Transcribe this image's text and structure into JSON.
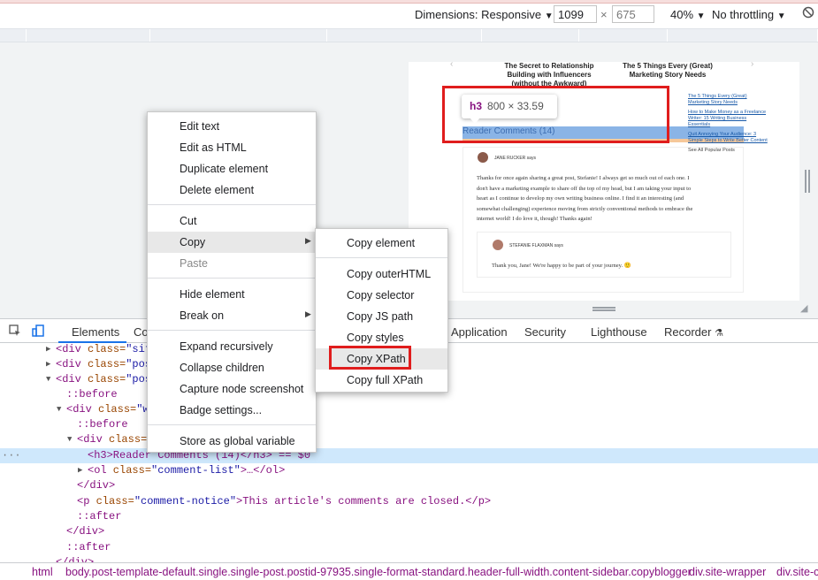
{
  "toolbar": {
    "dimensions_label": "Dimensions: Responsive",
    "width_value": "1099",
    "times": "×",
    "height_value": "675",
    "zoom": "40%",
    "throttling": "No throttling",
    "rotate_icon": "rotate-icon"
  },
  "preview": {
    "related_1": "The Secret to Relationship Building with Influencers (without the Awkward)",
    "related_1_a": "The Secret to Relationship",
    "related_1_b": "Building with Influencers",
    "related_1_c": "(without the Awkward)",
    "related_2_a": "The 5 Things Every (Great)",
    "related_2_b": "Marketing Story Needs",
    "heading": "Reader Comments (14)",
    "sidebar_links": [
      "The 5 Things Every (Great) Marketing Story Needs",
      "How to Make Money as a Freelance Writer: 15 Writing Business Essentials",
      "Quit Annoying Your Audience: 3 Simple Steps to Write Better Content"
    ],
    "sidebar_popular": "See All Popular Posts",
    "comment_author": "JANE RUCKER says",
    "comment_lines": [
      "Thanks for once again sharing a great post, Stefanie! I always get so much out of each one. I",
      "don't have a marketing example to share off the top of my head, but I am taking your input to",
      "heart as I continue to develop my own writing business online. I find it an interesting (and",
      "somewhat challenging) experience moving from strictly conventional methods to embrace the",
      "internet world! I do love it, though! Thanks again!"
    ],
    "reply_author": "STEFANIE FLAXMAN says",
    "reply_text": "Thank you, Jane! We're happy to be part of your journey. 🙂"
  },
  "tooltip": {
    "tag": "h3",
    "size": "800 × 33.59"
  },
  "devtools_tabs": {
    "elements": "Elements",
    "console_partial": "Co",
    "application": "Application",
    "security": "Security",
    "lighthouse": "Lighthouse",
    "recorder": "Recorder"
  },
  "tree": {
    "l1_tag": "<div",
    "l1_attr": " class=",
    "l1_val": "\"site",
    "l2_val": "\"post",
    "l3_val": "\"post",
    "before": "::before",
    "after": "::after",
    "l5_val": "\"wr",
    "l7_val": "\"",
    "selected_text": "<h3>Reader Comments (14)</h3> == $0",
    "ol_line_a": "<ol",
    "ol_attr": " class=",
    "ol_val": "\"comment-list\"",
    "ol_rest": ">…</ol>",
    "close_div": "</div>",
    "p_open": "<p",
    "p_attr": " class=",
    "p_val": "\"comment-notice\"",
    "p_text": ">This article's comments are closed.</p>",
    "ellipsis": "···",
    "last_partial": "</div>"
  },
  "breadcrumb": {
    "html": "html",
    "body": "body.post-template-default.single.single-post.postid-97935.single-format-standard.header-full-width.content-sidebar.copyblogger",
    "wrapper": "div.site-wrapper",
    "site_c": "div.site-c"
  },
  "context_menu": {
    "items": [
      "Edit text",
      "Edit as HTML",
      "Duplicate element",
      "Delete element",
      "Cut",
      "Copy",
      "Paste",
      "Hide element",
      "Break on",
      "Expand recursively",
      "Collapse children",
      "Capture node screenshot",
      "Badge settings...",
      "Store as global variable"
    ]
  },
  "copy_submenu": {
    "items": [
      "Copy element",
      "Copy outerHTML",
      "Copy selector",
      "Copy JS path",
      "Copy styles",
      "Copy XPath",
      "Copy full XPath"
    ]
  },
  "colors": {
    "highlight_box": "#e01d1d",
    "selected_row": "#cfe8fc",
    "tag_color": "#881280",
    "attr_name": "#994500",
    "attr_value": "#1a1aa6"
  }
}
